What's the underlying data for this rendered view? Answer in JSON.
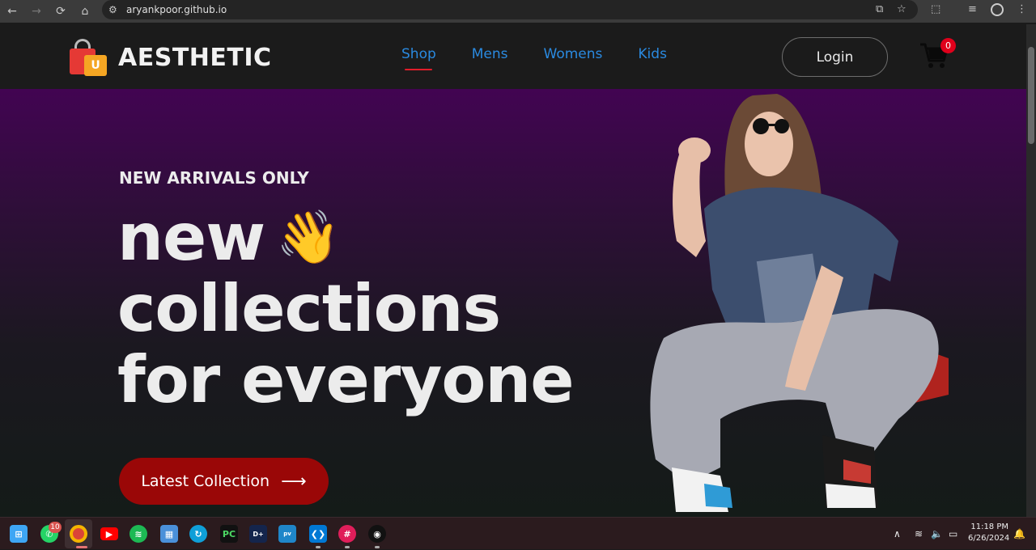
{
  "browser": {
    "url": "aryankpoor.github.io"
  },
  "navbar": {
    "brand": "AESTHETIC",
    "logo_letter": "U",
    "menu": [
      {
        "label": "Shop",
        "active": true
      },
      {
        "label": "Mens"
      },
      {
        "label": "Womens"
      },
      {
        "label": "Kids"
      }
    ],
    "login_label": "Login",
    "cart_count": "0"
  },
  "hero": {
    "kicker": "NEW ARRIVALS ONLY",
    "line1": "new",
    "line2": "collections",
    "line3": "for everyone",
    "wave_emoji": "👋",
    "cta_label": "Latest Collection",
    "cta_arrow": "⟶"
  },
  "taskbar": {
    "whatsapp_badge": "10",
    "time": "11:18 PM",
    "date": "6/26/2024"
  },
  "colors": {
    "accent_blue": "#2a8ae0",
    "cta_red": "#9a0707",
    "badge_red": "#e0001b",
    "hero_top": "#420452"
  }
}
